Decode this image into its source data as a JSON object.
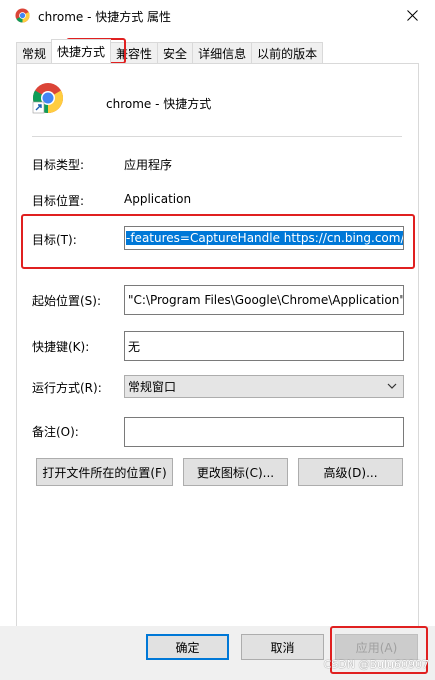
{
  "window": {
    "title": "chrome - 快捷方式 属性",
    "close_icon": "close-icon"
  },
  "tabs": [
    {
      "label": "常规",
      "active": false
    },
    {
      "label": "快捷方式",
      "active": true
    },
    {
      "label": "兼容性",
      "active": false
    },
    {
      "label": "安全",
      "active": false
    },
    {
      "label": "详细信息",
      "active": false
    },
    {
      "label": "以前的版本",
      "active": false
    }
  ],
  "shortcut": {
    "name": "chrome - 快捷方式",
    "target_type_label": "目标类型:",
    "target_type_value": "应用程序",
    "target_location_label": "目标位置:",
    "target_location_value": "Application",
    "target_label": "目标(T):",
    "target_value": "-features=CaptureHandle https://cn.bing.com/",
    "start_in_label": "起始位置(S):",
    "start_in_value": "\"C:\\Program Files\\Google\\Chrome\\Application\"",
    "hotkey_label": "快捷键(K):",
    "hotkey_value": "无",
    "run_label": "运行方式(R):",
    "run_value": "常规窗口",
    "comment_label": "备注(O):",
    "comment_value": ""
  },
  "actions": {
    "open_location": "打开文件所在的位置(F)",
    "change_icon": "更改图标(C)...",
    "advanced": "高级(D)..."
  },
  "footer": {
    "ok": "确定",
    "cancel": "取消",
    "apply": "应用(A)"
  },
  "watermark": "CSDN @Bulu60907",
  "colors": {
    "highlight": "#0078d7",
    "annotation_red": "#e02020"
  }
}
